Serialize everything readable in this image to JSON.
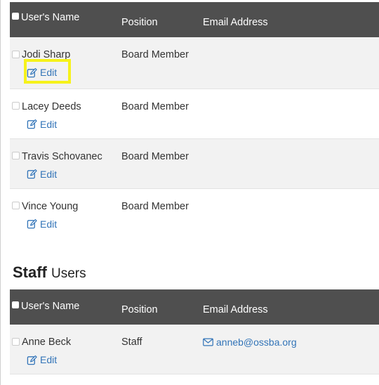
{
  "board_table": {
    "headers": {
      "name": "User's Name",
      "position": "Position",
      "email": "Email Address"
    },
    "rows": [
      {
        "name": "Jodi Sharp",
        "position": "Board Member",
        "email": "",
        "edit": "Edit"
      },
      {
        "name": "Lacey Deeds",
        "position": "Board Member",
        "email": "",
        "edit": "Edit"
      },
      {
        "name": "Travis Schovanec",
        "position": "Board Member",
        "email": "",
        "edit": "Edit"
      },
      {
        "name": "Vince Young",
        "position": "Board Member",
        "email": "",
        "edit": "Edit"
      }
    ]
  },
  "staff_section": {
    "title_strong": "Staff",
    "title_rest": "Users"
  },
  "staff_table": {
    "headers": {
      "name": "User's Name",
      "position": "Position",
      "email": "Email Address"
    },
    "rows": [
      {
        "name": "Anne Beck",
        "position": "Staff",
        "email": "anneb@ossba.org",
        "edit": "Edit"
      }
    ]
  },
  "icons": {
    "edit": "edit-icon",
    "email": "envelope-icon"
  },
  "colors": {
    "header_bg": "#4f4f4f",
    "link": "#3274b8",
    "highlight": "#f6f21b",
    "row_alt": "#f2f2f2"
  }
}
